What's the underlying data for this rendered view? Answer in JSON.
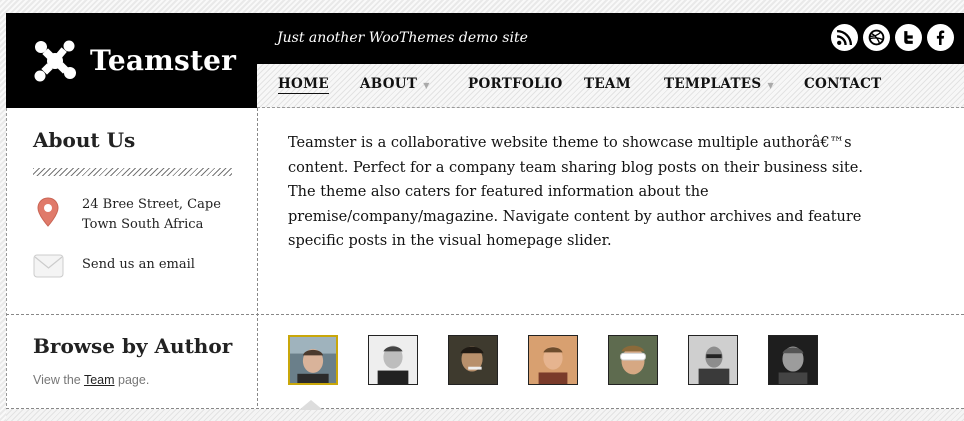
{
  "site": {
    "name": "Teamster",
    "tagline": "Just another WooThemes demo site"
  },
  "social": [
    {
      "name": "rss-icon"
    },
    {
      "name": "dribbble-icon"
    },
    {
      "name": "twitter-icon"
    },
    {
      "name": "facebook-icon"
    }
  ],
  "nav": {
    "items": [
      {
        "label": "HOME"
      },
      {
        "label": "ABOUT"
      },
      {
        "label": "PORTFOLIO"
      },
      {
        "label": "TEAM"
      },
      {
        "label": "TEMPLATES"
      },
      {
        "label": "CONTACT"
      }
    ]
  },
  "sidebar": {
    "about_title": "About Us",
    "address": "24 Bree Street, Cape Town South Africa",
    "email_label": "Send us an email",
    "browse_title": "Browse by Author",
    "browse_prefix": "View the ",
    "browse_link": "Team",
    "browse_suffix": " page."
  },
  "main": {
    "intro": "Teamster is a collaborative website theme to showcase multiple authorâ€™s content. Perfect for a company team sharing blog posts on their business site. The theme also caters for featured information about the premise/company/magazine. Navigate content by author archives and feature specific posts in the visual homepage slider."
  },
  "colors": {
    "brand": "#000000",
    "selected_border": "#c9a70a",
    "pin": "#e07a6a"
  }
}
